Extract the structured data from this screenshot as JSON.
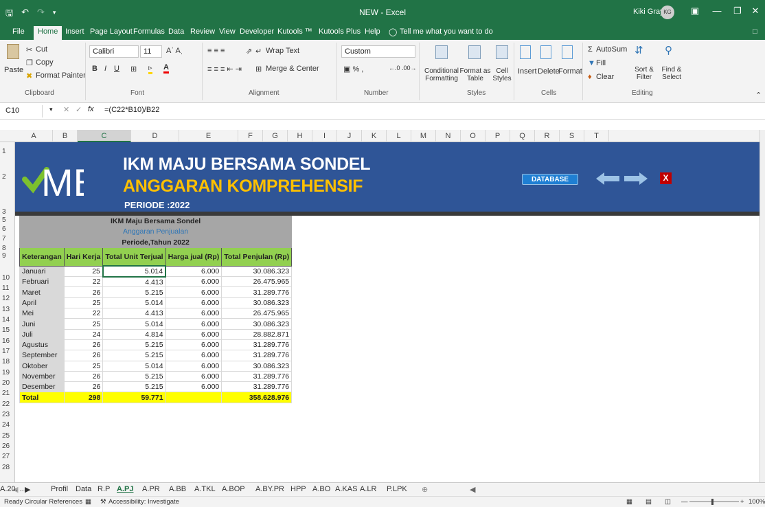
{
  "window": {
    "title": "NEW - Excel",
    "user": "Kiki Gray",
    "user_initials": "KG"
  },
  "ribbon_tabs": [
    "File",
    "Home",
    "Insert",
    "Page Layout",
    "Formulas",
    "Data",
    "Review",
    "View",
    "Developer",
    "Kutools ™",
    "Kutools Plus",
    "Help"
  ],
  "tell_me": "Tell me what you want to do",
  "ribbon": {
    "clipboard": {
      "paste": "Paste",
      "cut": "Cut",
      "copy": "Copy",
      "format_painter": "Format Painter",
      "group": "Clipboard"
    },
    "font": {
      "name": "Calibri",
      "size": "11",
      "group": "Font"
    },
    "alignment": {
      "wrap": "Wrap Text",
      "merge": "Merge & Center",
      "group": "Alignment"
    },
    "number": {
      "format": "Custom",
      "group": "Number"
    },
    "styles": {
      "conditional": "Conditional Formatting",
      "format_table": "Format as Table",
      "cell_styles": "Cell Styles",
      "group": "Styles"
    },
    "cells": {
      "insert": "Insert",
      "delete": "Delete",
      "format": "Format",
      "group": "Cells"
    },
    "editing": {
      "autosum": "AutoSum",
      "fill": "Fill",
      "clear": "Clear",
      "sort": "Sort & Filter",
      "find": "Find & Select",
      "group": "Editing"
    }
  },
  "formula_bar": {
    "name_box": "C10",
    "fx": "fx",
    "formula": "=(C22*B10)/B22"
  },
  "columns": [
    "A",
    "B",
    "C",
    "D",
    "E",
    "F",
    "G",
    "H",
    "I",
    "J",
    "K",
    "L",
    "M",
    "N",
    "O",
    "P",
    "Q",
    "R",
    "S",
    "T"
  ],
  "rows": [
    "1",
    "2",
    "3",
    "5",
    "6",
    "7",
    "8",
    "9",
    "10",
    "11",
    "12",
    "13",
    "14",
    "15",
    "16",
    "17",
    "18",
    "19",
    "20",
    "21",
    "22",
    "23",
    "24",
    "25",
    "26",
    "27",
    "28"
  ],
  "banner": {
    "line1": "IKM MAJU BERSAMA SONDEL",
    "line2": "ANGGARAN KOMPREHENSIF",
    "line3": "PERIODE :2022",
    "database_button": "DATABASE",
    "close_button": "X"
  },
  "table": {
    "title1": "IKM Maju Bersama Sondel",
    "title2": "Anggaran Penjualan",
    "title3": "Periode,Tahun 2022",
    "headers": [
      "Keterangan",
      "Hari Kerja",
      "Total Unit Terjual",
      "Harga jual (Rp)",
      "Total Penjulan (Rp)"
    ],
    "rows": [
      [
        "Januari",
        "25",
        "5.014",
        "6.000",
        "30.086.323"
      ],
      [
        "Februari",
        "22",
        "4.413",
        "6.000",
        "26.475.965"
      ],
      [
        "Maret",
        "26",
        "5.215",
        "6.000",
        "31.289.776"
      ],
      [
        "April",
        "25",
        "5.014",
        "6.000",
        "30.086.323"
      ],
      [
        "Mei",
        "22",
        "4.413",
        "6.000",
        "26.475.965"
      ],
      [
        "Juni",
        "25",
        "5.014",
        "6.000",
        "30.086.323"
      ],
      [
        "Juli",
        "24",
        "4.814",
        "6.000",
        "28.882.871"
      ],
      [
        "Agustus",
        "26",
        "5.215",
        "6.000",
        "31.289.776"
      ],
      [
        "September",
        "26",
        "5.215",
        "6.000",
        "31.289.776"
      ],
      [
        "Oktober",
        "25",
        "5.014",
        "6.000",
        "30.086.323"
      ],
      [
        "November",
        "26",
        "5.215",
        "6.000",
        "31.289.776"
      ],
      [
        "Desember",
        "26",
        "5.215",
        "6.000",
        "31.289.776"
      ]
    ],
    "total": [
      "Total",
      "298",
      "59.771",
      "",
      "358.628.976"
    ]
  },
  "sheet_tabs": [
    "Profil",
    "Data",
    "R.P",
    "A.PJ",
    "A.PR",
    "A.BB",
    "A.TKL",
    "A.BOP",
    "A.BY.PR",
    "HPP",
    "A.BO",
    "A.KAS",
    "A.LR",
    "P.LPK",
    "A.20. ..."
  ],
  "active_sheet": "A.PJ",
  "status": {
    "ready": "Ready",
    "circular": "Circular References",
    "accessibility": "Accessibility: Investigate",
    "zoom": "100%"
  },
  "colors": {
    "excel_green": "#217346",
    "banner_blue": "#2f5597",
    "header_green": "#92d050",
    "total_yellow": "#ffff00",
    "gold": "#ffc000"
  }
}
